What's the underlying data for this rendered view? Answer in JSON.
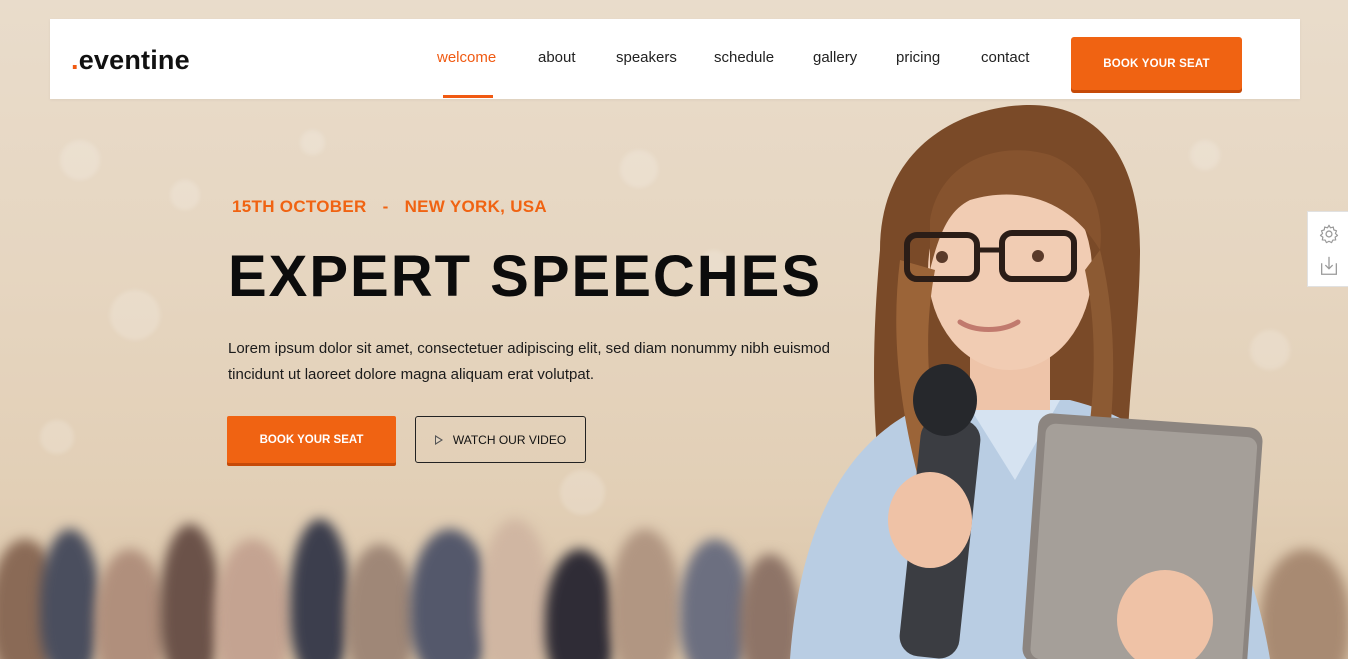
{
  "brand": {
    "dot": ".",
    "name": "eventine"
  },
  "nav": {
    "items": [
      {
        "label": "welcome",
        "active": true
      },
      {
        "label": "about",
        "active": false
      },
      {
        "label": "speakers",
        "active": false
      },
      {
        "label": "schedule",
        "active": false
      },
      {
        "label": "gallery",
        "active": false
      },
      {
        "label": "pricing",
        "active": false
      },
      {
        "label": "contact",
        "active": false
      }
    ],
    "cta_label": "BOOK YOUR SEAT"
  },
  "hero": {
    "date": "15TH OCTOBER",
    "separator": "-",
    "location": "NEW YORK, USA",
    "title": "EXPERT SPEECHES",
    "description": "Lorem ipsum dolor sit amet, consectetuer adipiscing elit, sed diam nonummy nibh euismod tincidunt ut laoreet dolore magna aliquam erat volutpat.",
    "primary_button": "BOOK YOUR SEAT",
    "secondary_button": "WATCH OUR VIDEO"
  },
  "side_panel": {
    "icons": [
      "gear-icon",
      "download-icon"
    ]
  },
  "colors": {
    "accent": "#f06312",
    "text": "#0c0c0c",
    "navbar_bg": "#ffffff"
  }
}
